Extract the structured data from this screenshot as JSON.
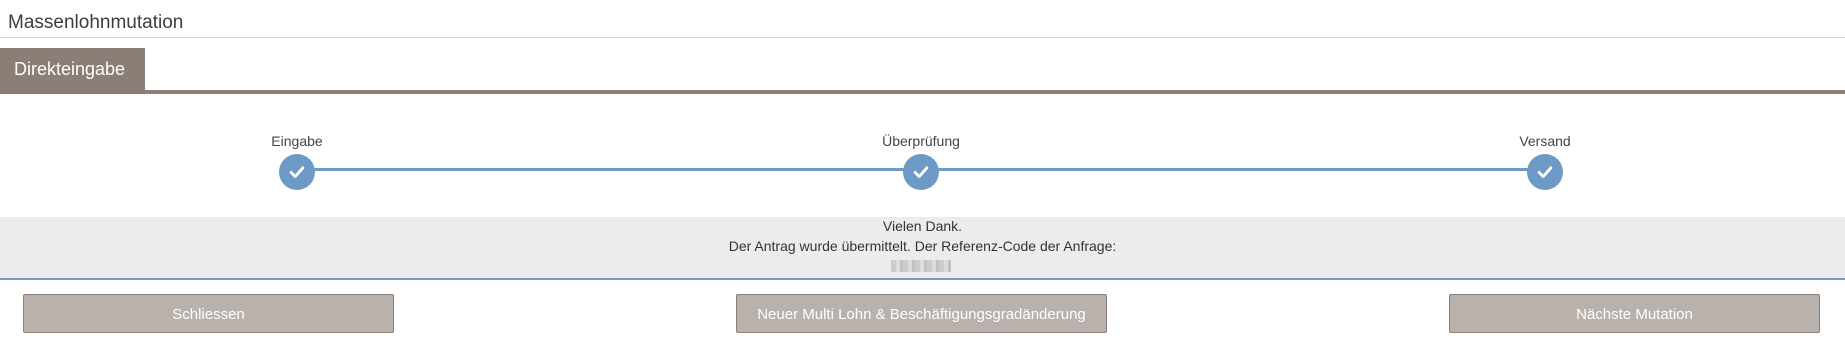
{
  "page": {
    "title": "Massenlohnmutation"
  },
  "tabs": [
    {
      "label": "Direkteingabe",
      "active": true
    }
  ],
  "stepper": {
    "steps": [
      {
        "label": "Eingabe",
        "completed": true,
        "icon": "check-icon"
      },
      {
        "label": "Überprüfung",
        "completed": true,
        "icon": "check-icon"
      },
      {
        "label": "Versand",
        "completed": true,
        "icon": "check-icon"
      }
    ]
  },
  "message": {
    "line1": "Vielen Dank.",
    "line2": "Der Antrag wurde übermittelt. Der Referenz-Code der Anfrage:",
    "reference_code_redacted": true
  },
  "buttons": {
    "close": "Schliessen",
    "new_change": "Neuer Multi Lohn & Beschäftigungsgradänderung",
    "next_mutation": "Nächste Mutation"
  },
  "colors": {
    "accent_blue": "#6d9ac6",
    "tab_brown": "#8b7e76",
    "button_gray": "#b9b1ab",
    "message_bg": "#ececec"
  }
}
